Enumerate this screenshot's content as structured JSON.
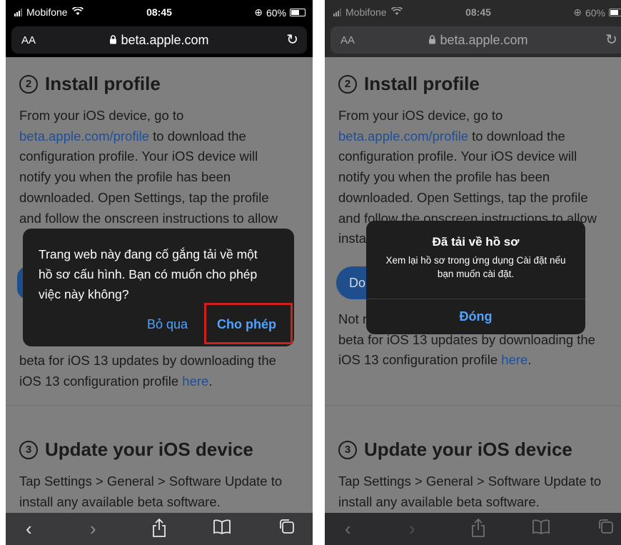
{
  "status": {
    "carrier": "Mobifone",
    "time": "08:45",
    "battery": "60%"
  },
  "browser": {
    "text_size": "AA",
    "url": "beta.apple.com"
  },
  "page": {
    "section2_num": "2",
    "section2_title": "Install profile",
    "section2_para": [
      "From your iOS device, go to",
      "beta.apple.com/profile",
      " to download the",
      "configuration profile. Your iOS device will",
      "notify you when the profile has been",
      "downloaded. Open Settings, tap the profile",
      "and follow the onscreen instructions to allow"
    ],
    "line_partial": "insta",
    "download_btn": "Do",
    "note_start": "Not r",
    "note_line2": "beta for iOS 13 updates by downloading the",
    "note_line3_a": "iOS 13 configuration profile ",
    "note_line3_link": "here",
    "note_line3_end": ".",
    "section3_num": "3",
    "section3_title": "Update your iOS device",
    "section3_para": [
      "Tap Settings > General > Software Update to",
      "install any available beta software."
    ]
  },
  "dialog_left": {
    "message": "Trang web này đang cố gắng tải về một hồ sơ cấu hình. Bạn có muốn cho phép việc này không?",
    "ignore": "Bỏ qua",
    "allow": "Cho phép"
  },
  "dialog_right": {
    "title": "Đã tải về hồ sơ",
    "message": "Xem lại hồ sơ trong ứng dụng Cài đặt nếu bạn muốn cài đặt.",
    "close": "Đóng"
  },
  "toolbar_icons": [
    "back-icon",
    "forward-icon",
    "share-icon",
    "bookmarks-icon",
    "tabs-icon"
  ],
  "colors": {
    "link": "#1e4f9a",
    "dialog_button": "#4fa3ff",
    "highlight": "#cf1f1f"
  }
}
